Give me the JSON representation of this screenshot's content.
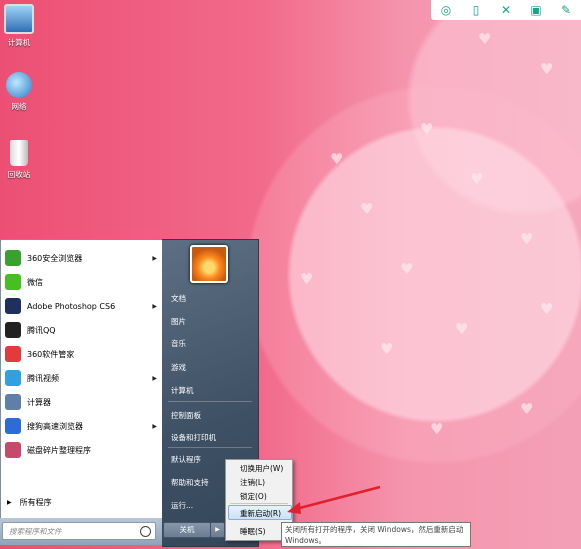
{
  "desktop": {
    "icons": [
      {
        "label": "计算机",
        "icon": "computer-icon"
      },
      {
        "label": "网络",
        "icon": "network-icon"
      },
      {
        "label": "回收站",
        "icon": "recycle-bin-icon"
      }
    ]
  },
  "toolbar": {
    "icons": [
      "scan-icon",
      "phone-icon",
      "expand-icon",
      "save-icon",
      "edit-icon"
    ]
  },
  "start_menu": {
    "programs": [
      {
        "label": "360安全浏览器",
        "has_submenu": true,
        "color": "#3aa02f"
      },
      {
        "label": "微信",
        "has_submenu": false,
        "color": "#46c01f"
      },
      {
        "label": "Adobe Photoshop CS6",
        "has_submenu": true,
        "color": "#1f2f60"
      },
      {
        "label": "腾讯QQ",
        "has_submenu": false,
        "color": "#222222"
      },
      {
        "label": "360软件管家",
        "has_submenu": false,
        "color": "#e33b3b"
      },
      {
        "label": "腾讯视频",
        "has_submenu": true,
        "color": "#2fa0e0"
      },
      {
        "label": "计算器",
        "has_submenu": false,
        "color": "#5d7fa8"
      },
      {
        "label": "搜狗高速浏览器",
        "has_submenu": true,
        "color": "#2d6bd8"
      },
      {
        "label": "磁盘碎片整理程序",
        "has_submenu": false,
        "color": "#c84a6a"
      }
    ],
    "all_programs": "所有程序",
    "search_placeholder": "搜索程序和文件",
    "right_items": [
      "文档",
      "图片",
      "音乐",
      "游戏",
      "计算机",
      "控制面板",
      "设备和打印机",
      "默认程序",
      "帮助和支持",
      "运行..."
    ],
    "shutdown_label": "关机"
  },
  "shutdown_submenu": {
    "items": [
      "切换用户(W)",
      "注销(L)",
      "锁定(O)",
      "重新启动(R)",
      "睡眠(S)"
    ],
    "highlighted_index": 3
  },
  "tooltip": {
    "line1": "关闭所有打开的程序，关闭 Windows，然后重新启动",
    "line2": "Windows。"
  },
  "accent": {
    "arrow": "#e0202b",
    "highlight": "#cbe1f6"
  }
}
